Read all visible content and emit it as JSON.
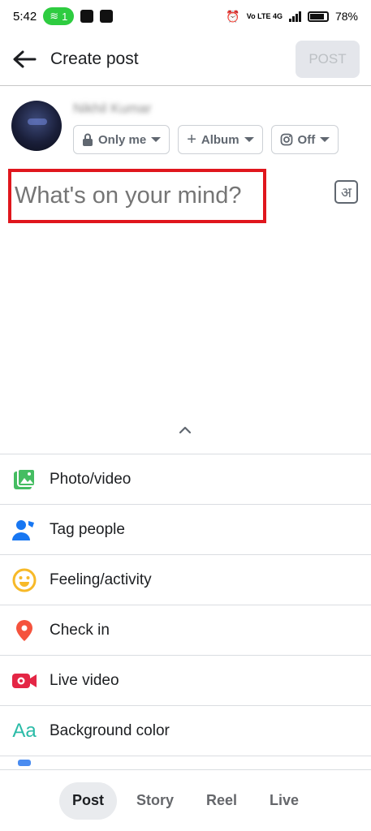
{
  "status_bar": {
    "time": "5:42",
    "wifi_badge": "1",
    "battery": "78%",
    "network": "Vo LTE 4G"
  },
  "header": {
    "title": "Create post",
    "post_label": "POST"
  },
  "profile": {
    "name": "Nikhil Kumar",
    "privacy": "Only me",
    "album": "Album",
    "instagram": "Off"
  },
  "composer": {
    "placeholder": "What's on your mind?",
    "translit_glyph": "अ"
  },
  "options": [
    {
      "label": "Photo/video",
      "icon": "photo-video-icon",
      "color": "#45bd62"
    },
    {
      "label": "Tag people",
      "icon": "tag-people-icon",
      "color": "#1877f2"
    },
    {
      "label": "Feeling/activity",
      "icon": "feeling-icon",
      "color": "#f7b928"
    },
    {
      "label": "Check in",
      "icon": "check-in-icon",
      "color": "#f5533d"
    },
    {
      "label": "Live video",
      "icon": "live-video-icon",
      "color": "#e42645"
    },
    {
      "label": "Background color",
      "icon": "background-color-icon",
      "color": "#2abba7"
    }
  ],
  "tabs": [
    {
      "label": "Post",
      "active": true
    },
    {
      "label": "Story",
      "active": false
    },
    {
      "label": "Reel",
      "active": false
    },
    {
      "label": "Live",
      "active": false
    }
  ]
}
